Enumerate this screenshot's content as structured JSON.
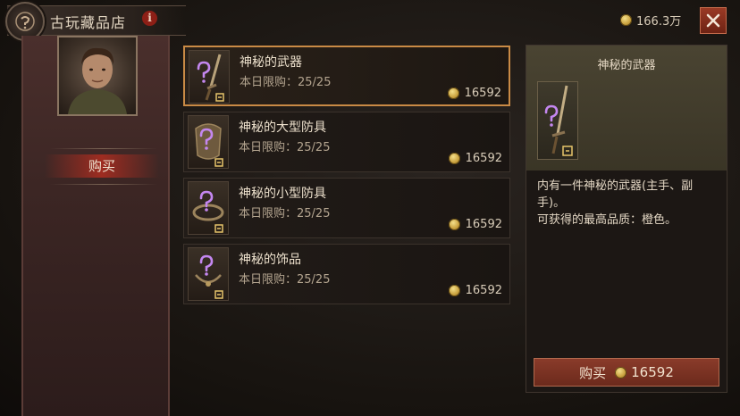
{
  "header": {
    "shop_title": "古玩藏品店",
    "info_icon": "i",
    "gold_amount": "166.3万",
    "close_icon": "close-icon"
  },
  "sidebar": {
    "tab_buy": "购买"
  },
  "items": [
    {
      "name": "神秘的武器",
      "limit": "本日限购：25/25",
      "price": "16592",
      "icon": "weapon-icon",
      "selected": true
    },
    {
      "name": "神秘的大型防具",
      "limit": "本日限购：25/25",
      "price": "16592",
      "icon": "large-armor-icon",
      "selected": false
    },
    {
      "name": "神秘的小型防具",
      "limit": "本日限购：25/25",
      "price": "16592",
      "icon": "small-armor-icon",
      "selected": false
    },
    {
      "name": "神秘的饰品",
      "limit": "本日限购：25/25",
      "price": "16592",
      "icon": "jewelry-icon",
      "selected": false
    }
  ],
  "detail": {
    "title": "神秘的武器",
    "desc_line1": "内有一件神秘的武器(主手、副手)。",
    "desc_line2": "可获得的最高品质：橙色。",
    "buy_label": "购买",
    "buy_price": "16592"
  },
  "colors": {
    "accent_red": "#8a3b2a",
    "selected_border": "#c98a45",
    "mystery_purple": "#c487f0",
    "gold": "#c9a13e"
  }
}
